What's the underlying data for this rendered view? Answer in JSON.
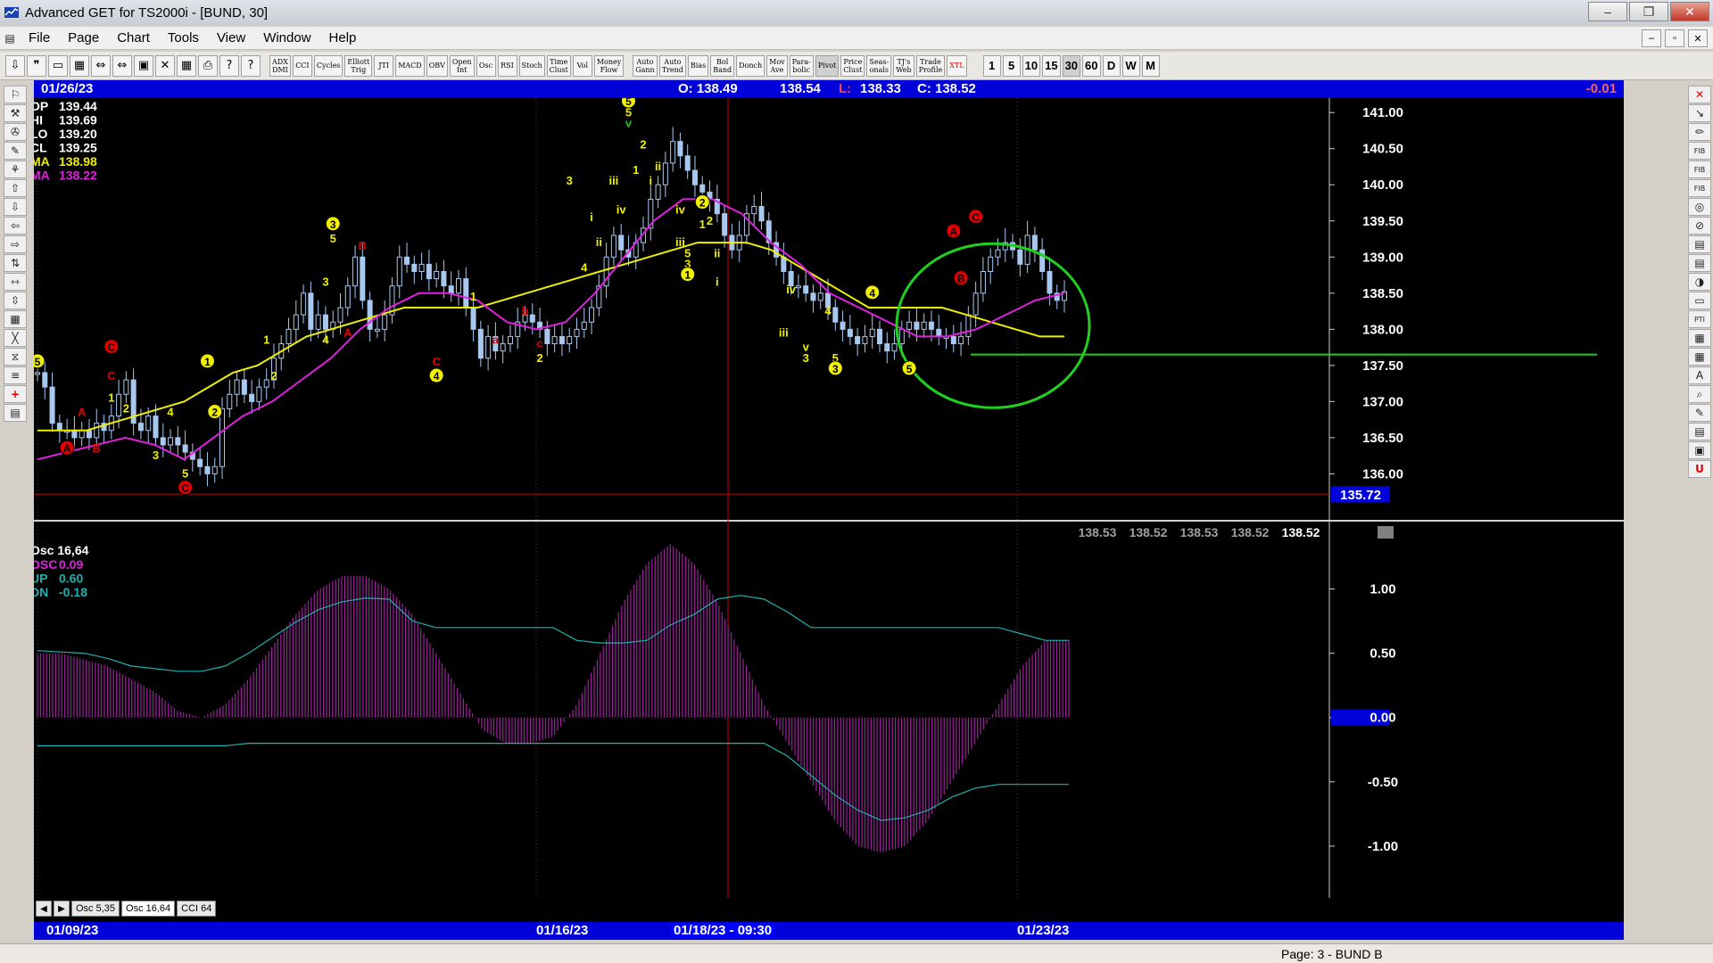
{
  "window": {
    "title": "Advanced GET for TS2000i - [BUND, 30]",
    "minimize": "‒",
    "restore": "❐",
    "close": "✕"
  },
  "menu": {
    "items": [
      "File",
      "Page",
      "Chart",
      "Tools",
      "View",
      "Window",
      "Help"
    ],
    "mdi": [
      "–",
      "▫",
      "✕"
    ]
  },
  "toolbar": {
    "icons1": [
      "⇩",
      "❞",
      "▭",
      "▦",
      "⇔",
      "⇔",
      "▣",
      "✕",
      "▦",
      "⎙",
      "?",
      "?"
    ],
    "studies": [
      {
        "label": "ADX\nDMI"
      },
      {
        "label": "CCI"
      },
      {
        "label": "Cycles"
      },
      {
        "label": "Elliott\nTrig"
      },
      {
        "label": "JTI"
      },
      {
        "label": "MACD"
      },
      {
        "label": "OBV"
      },
      {
        "label": "Open\nInt"
      },
      {
        "label": "Osc"
      },
      {
        "label": "RSI"
      },
      {
        "label": "Stoch"
      },
      {
        "label": "Time\nClust"
      },
      {
        "label": "Vol"
      },
      {
        "label": "Money\nFlow"
      }
    ],
    "studies2": [
      {
        "label": "Auto\nGann"
      },
      {
        "label": "Auto\nTrend"
      },
      {
        "label": "Bias"
      },
      {
        "label": "Bol\nBand"
      },
      {
        "label": "Donch"
      },
      {
        "label": "Mov\nAve"
      },
      {
        "label": "Para-\nbolic"
      },
      {
        "label": "Pivot"
      },
      {
        "label": "Price\nClust"
      },
      {
        "label": "Seas-\nonals"
      },
      {
        "label": "TJ's\nWeb"
      },
      {
        "label": "Trade\nProfile"
      },
      {
        "label": "XTL"
      }
    ],
    "timeframes": [
      "1",
      "5",
      "10",
      "15",
      "30",
      "60",
      "D",
      "W",
      "M"
    ],
    "active_timeframe": "30"
  },
  "left_tools": [
    "⚐",
    "⚒",
    "✇",
    "✎",
    "⚘",
    "⇧",
    "⇩",
    "⇦",
    "⇨",
    "⇅",
    "⇿",
    "⇳",
    "▦",
    "╳",
    "⧖",
    "≡",
    "+",
    "▤"
  ],
  "right_tools": [
    "✕",
    "↘",
    "✏",
    "FIB",
    "FIB",
    "FIB",
    "◎",
    "⊘",
    "▤",
    "▤",
    "◑",
    "▭",
    "PTI",
    "▦",
    "▦",
    "A",
    "⌕",
    "✎",
    "▤",
    "▣",
    "U"
  ],
  "info": {
    "date": "01/26/23",
    "open": "O: 138.49",
    "high": "138.54",
    "low_label": "L:",
    "low": "138.33",
    "close": "C: 138.52",
    "change": "-0.01"
  },
  "readout": [
    {
      "label": "OP",
      "value": "139.44",
      "color": "#ffffff"
    },
    {
      "label": "HI",
      "value": "139.69",
      "color": "#ffffff"
    },
    {
      "label": "LO",
      "value": "139.20",
      "color": "#ffffff"
    },
    {
      "label": "CL",
      "value": "139.25",
      "color": "#ffffff"
    },
    {
      "label": "MA",
      "value": "138.98",
      "color": "#f0f000"
    },
    {
      "label": "MA",
      "value": "138.22",
      "color": "#e020e0"
    }
  ],
  "price_axis": {
    "labels": [
      "141.00",
      "140.50",
      "140.00",
      "139.50",
      "139.00",
      "138.50",
      "138.00",
      "137.50",
      "137.00",
      "136.50",
      "136.00"
    ],
    "values": [
      141,
      140.5,
      140,
      139.5,
      139,
      138.5,
      138,
      137.5,
      137,
      136.5,
      136
    ],
    "highlight_label": "135.72",
    "highlight_value": 135.72,
    "min": 135.4,
    "max": 141.2
  },
  "price_history_row": [
    "138.53",
    "138.52",
    "138.53",
    "138.52",
    "138.52"
  ],
  "osc": {
    "title": "Osc 16,64",
    "legend": [
      {
        "label": "OSC",
        "value": "0.09",
        "color": "#e020e0"
      },
      {
        "label": "UP",
        "value": "0.60",
        "color": "#20b0b0"
      },
      {
        "label": "DN",
        "value": "-0.18",
        "color": "#20b0b0"
      }
    ],
    "axis_labels": [
      "1.00",
      "0.50",
      "0.00",
      "-0.50",
      "-1.00"
    ],
    "axis_values": [
      1,
      0.5,
      0,
      -0.5,
      -1
    ],
    "highlight_label": "0.00",
    "min": -1.25,
    "max": 1.35
  },
  "tabs": [
    "Osc 5,35",
    "Osc 16,64",
    "CCI 64"
  ],
  "active_tab": "Osc 16,64",
  "dates": [
    "01/09/23",
    "01/16/23",
    "01/18/23 - 09:30",
    "01/23/23"
  ],
  "status": "Page: 3 - BUND B",
  "colors": {
    "background": "#000000",
    "candle": "#a8c8f0",
    "ma_fast": "#f0f000",
    "ma_slow": "#e020e0",
    "circle": "#20d020",
    "support_line": "#20d020",
    "osc_bars": "#a020a0",
    "bands": "#20b0b0",
    "cursor_line": "#d00000",
    "info_bar": "#0000d8"
  },
  "chart_data": {
    "type": "candlestick",
    "closes": [
      137.4,
      137.2,
      136.7,
      136.6,
      136.6,
      136.5,
      136.6,
      136.5,
      136.7,
      136.6,
      136.8,
      137.1,
      137.3,
      136.7,
      136.6,
      136.8,
      136.5,
      136.4,
      136.5,
      136.4,
      136.3,
      136.2,
      136.1,
      136.0,
      136.1,
      136.9,
      137.1,
      137.3,
      137.1,
      137.0,
      137.2,
      137.3,
      137.6,
      137.8,
      138.0,
      138.2,
      138.5,
      138.0,
      138.2,
      138.0,
      138.1,
      138.3,
      138.6,
      139.0,
      138.4,
      138.0,
      138.0,
      138.2,
      138.6,
      139.0,
      138.9,
      138.8,
      138.9,
      138.7,
      138.8,
      138.6,
      138.5,
      138.7,
      138.3,
      138.0,
      137.6,
      137.9,
      137.7,
      137.8,
      137.9,
      138.1,
      138.2,
      138.1,
      138.0,
      137.8,
      137.9,
      137.8,
      137.9,
      138.0,
      138.1,
      138.3,
      138.6,
      139.0,
      139.3,
      139.1,
      139.0,
      139.2,
      139.4,
      139.8,
      140.0,
      140.3,
      140.6,
      140.4,
      140.2,
      140.0,
      139.9,
      139.8,
      139.6,
      139.3,
      139.1,
      139.3,
      139.6,
      139.7,
      139.5,
      139.2,
      139.0,
      138.8,
      138.6,
      138.6,
      138.5,
      138.4,
      138.5,
      138.3,
      138.1,
      138.0,
      137.9,
      137.8,
      137.9,
      138.0,
      137.8,
      137.7,
      137.8,
      138.0,
      138.1,
      138.0,
      138.1,
      138.0,
      137.9,
      137.9,
      137.8,
      137.9,
      138.2,
      138.5,
      138.8,
      139.0,
      139.1,
      139.2,
      139.1,
      138.9,
      139.3,
      139.1,
      138.8,
      138.5,
      138.4,
      138.52
    ],
    "ma_fast": [
      136.6,
      136.6,
      136.6,
      136.7,
      136.8,
      136.9,
      137.0,
      137.2,
      137.4,
      137.5,
      137.7,
      137.9,
      138.0,
      138.1,
      138.2,
      138.3,
      138.3,
      138.3,
      138.3,
      138.4,
      138.5,
      138.6,
      138.7,
      138.8,
      138.9,
      139.0,
      139.1,
      139.2,
      139.2,
      139.2,
      139.1,
      138.9,
      138.7,
      138.5,
      138.3,
      138.3,
      138.3,
      138.3,
      138.2,
      138.1,
      138.0,
      137.9,
      137.9
    ],
    "ma_slow": [
      136.2,
      136.3,
      136.4,
      136.5,
      136.4,
      136.2,
      136.5,
      136.8,
      137.0,
      137.3,
      137.6,
      138.0,
      138.3,
      138.5,
      138.5,
      138.4,
      138.1,
      138.0,
      138.1,
      138.5,
      139.0,
      139.5,
      139.8,
      139.8,
      139.6,
      139.2,
      138.9,
      138.5,
      138.3,
      138.1,
      137.9,
      137.9,
      138.0,
      138.2,
      138.4,
      138.5
    ],
    "osc": [
      0.5,
      0.5,
      0.45,
      0.4,
      0.3,
      0.2,
      0.05,
      0.0,
      0.1,
      0.3,
      0.55,
      0.8,
      1.0,
      1.1,
      1.1,
      1.0,
      0.8,
      0.5,
      0.2,
      -0.1,
      -0.2,
      -0.2,
      -0.15,
      0.1,
      0.5,
      0.9,
      1.2,
      1.35,
      1.2,
      0.9,
      0.5,
      0.1,
      -0.2,
      -0.5,
      -0.8,
      -1.0,
      -1.05,
      -1.0,
      -0.8,
      -0.5,
      -0.2,
      0.1,
      0.4,
      0.6,
      0.6
    ],
    "upper_band": [
      0.52,
      0.51,
      0.5,
      0.46,
      0.4,
      0.38,
      0.36,
      0.36,
      0.4,
      0.5,
      0.62,
      0.74,
      0.84,
      0.9,
      0.93,
      0.92,
      0.75,
      0.7,
      0.7,
      0.7,
      0.7,
      0.7,
      0.7,
      0.6,
      0.58,
      0.58,
      0.6,
      0.72,
      0.8,
      0.92,
      0.95,
      0.92,
      0.82,
      0.7,
      0.7,
      0.7,
      0.7,
      0.7,
      0.7,
      0.7,
      0.7,
      0.7,
      0.65,
      0.6,
      0.6
    ],
    "lower_band": [
      -0.22,
      -0.22,
      -0.22,
      -0.22,
      -0.22,
      -0.22,
      -0.22,
      -0.22,
      -0.22,
      -0.2,
      -0.2,
      -0.2,
      -0.2,
      -0.2,
      -0.2,
      -0.2,
      -0.2,
      -0.2,
      -0.2,
      -0.2,
      -0.2,
      -0.2,
      -0.2,
      -0.2,
      -0.2,
      -0.2,
      -0.2,
      -0.2,
      -0.2,
      -0.2,
      -0.2,
      -0.2,
      -0.3,
      -0.45,
      -0.6,
      -0.72,
      -0.8,
      -0.78,
      -0.72,
      -0.62,
      -0.55,
      -0.52,
      -0.52,
      -0.52,
      -0.52
    ],
    "support_level": 137.65,
    "low_line_level": 135.72
  },
  "wave_labels": [
    {
      "t": "5",
      "c": "#f0f000",
      "idx": 0,
      "p": 137.5,
      "circle": true,
      "circleColor": "#e00000",
      "ring": "C"
    },
    {
      "t": "A",
      "c": "#e00000",
      "idx": 6,
      "p": 136.8
    },
    {
      "t": "A",
      "c": "#e00000",
      "idx": 4,
      "p": 136.3,
      "circle": true
    },
    {
      "t": "B",
      "c": "#e00000",
      "idx": 8,
      "p": 136.3
    },
    {
      "t": "C",
      "c": "#e00000",
      "idx": 10,
      "p": 137.7,
      "circle": true
    },
    {
      "t": "C",
      "c": "#e00000",
      "idx": 10,
      "p": 137.3
    },
    {
      "t": "1",
      "c": "#f0f000",
      "idx": 10,
      "p": 137.0
    },
    {
      "t": "2",
      "c": "#f0f000",
      "idx": 12,
      "p": 136.85
    },
    {
      "t": "3",
      "c": "#f0f000",
      "idx": 16,
      "p": 136.2
    },
    {
      "t": "4",
      "c": "#f0f000",
      "idx": 18,
      "p": 136.8
    },
    {
      "t": "5",
      "c": "#f0f000",
      "idx": 20,
      "p": 135.95
    },
    {
      "t": "C",
      "c": "#e00000",
      "idx": 20,
      "p": 135.75,
      "circle": true
    },
    {
      "t": "1",
      "c": "#f0f000",
      "idx": 23,
      "p": 137.5,
      "circle": true
    },
    {
      "t": "2",
      "c": "#f0f000",
      "idx": 24,
      "p": 136.8,
      "circle": true
    },
    {
      "t": "1",
      "c": "#f0f000",
      "idx": 31,
      "p": 137.8
    },
    {
      "t": "2",
      "c": "#f0f000",
      "idx": 32,
      "p": 137.3
    },
    {
      "t": "3",
      "c": "#f0f000",
      "idx": 40,
      "p": 139.4,
      "circle": true
    },
    {
      "t": "5",
      "c": "#f0f000",
      "idx": 40,
      "p": 139.2
    },
    {
      "t": "3",
      "c": "#f0f000",
      "idx": 39,
      "p": 138.6
    },
    {
      "t": "4",
      "c": "#f0f000",
      "idx": 39,
      "p": 137.8
    },
    {
      "t": "A",
      "c": "#e00000",
      "idx": 42,
      "p": 137.9
    },
    {
      "t": "B",
      "c": "#e00000",
      "idx": 44,
      "p": 139.1
    },
    {
      "t": "C",
      "c": "#e00000",
      "idx": 54,
      "p": 137.5
    },
    {
      "t": "4",
      "c": "#f0f000",
      "idx": 54,
      "p": 137.3,
      "circle": true
    },
    {
      "t": "1",
      "c": "#f0f000",
      "idx": 59,
      "p": 138.4
    },
    {
      "t": "b",
      "c": "#e00000",
      "idx": 66,
      "p": 138.2
    },
    {
      "t": "a",
      "c": "#e00000",
      "idx": 62,
      "p": 137.8
    },
    {
      "t": "c",
      "c": "#e00000",
      "idx": 68,
      "p": 137.75
    },
    {
      "t": "2",
      "c": "#f0f000",
      "idx": 68,
      "p": 137.55
    },
    {
      "t": "3",
      "c": "#f0f000",
      "idx": 72,
      "p": 140.0
    },
    {
      "t": "4",
      "c": "#f0f000",
      "idx": 74,
      "p": 138.8
    },
    {
      "t": "i",
      "c": "#f0f000",
      "idx": 75,
      "p": 139.5
    },
    {
      "t": "ii",
      "c": "#f0f000",
      "idx": 76,
      "p": 139.15
    },
    {
      "t": "iii",
      "c": "#f0f000",
      "idx": 78,
      "p": 140.0
    },
    {
      "t": "iv",
      "c": "#f0f000",
      "idx": 79,
      "p": 139.6
    },
    {
      "t": "5",
      "c": "#f0f000",
      "idx": 80,
      "p": 141.1,
      "circle": true
    },
    {
      "t": "5",
      "c": "#f0f000",
      "idx": 80,
      "p": 140.95
    },
    {
      "t": "v",
      "c": "#20c020",
      "idx": 80,
      "p": 140.8
    },
    {
      "t": "2",
      "c": "#f0f000",
      "idx": 82,
      "p": 140.5
    },
    {
      "t": "1",
      "c": "#f0f000",
      "idx": 81,
      "p": 140.15
    },
    {
      "t": "i",
      "c": "#f0f000",
      "idx": 83,
      "p": 140.0
    },
    {
      "t": "ii",
      "c": "#f0f000",
      "idx": 84,
      "p": 140.2
    },
    {
      "t": "iv",
      "c": "#f0f000",
      "idx": 87,
      "p": 139.6
    },
    {
      "t": "2",
      "c": "#f0f000",
      "idx": 90,
      "p": 139.7,
      "circle": true
    },
    {
      "t": "1",
      "c": "#f0f000",
      "idx": 90,
      "p": 139.4
    },
    {
      "t": "2",
      "c": "#f0f000",
      "idx": 91,
      "p": 139.45
    },
    {
      "t": "iii",
      "c": "#f0f000",
      "idx": 87,
      "p": 139.15
    },
    {
      "t": "5",
      "c": "#f0f000",
      "idx": 88,
      "p": 139.0
    },
    {
      "t": "3",
      "c": "#f0f000",
      "idx": 88,
      "p": 138.85
    },
    {
      "t": "1",
      "c": "#f0f000",
      "idx": 88,
      "p": 138.7,
      "circle": true
    },
    {
      "t": "ii",
      "c": "#f0f000",
      "idx": 92,
      "p": 139.0
    },
    {
      "t": "i",
      "c": "#f0f000",
      "idx": 92,
      "p": 138.6
    },
    {
      "t": "iv",
      "c": "#f0f000",
      "idx": 102,
      "p": 138.5
    },
    {
      "t": "iii",
      "c": "#f0f000",
      "idx": 101,
      "p": 137.9
    },
    {
      "t": "4",
      "c": "#f0f000",
      "idx": 107,
      "p": 138.2
    },
    {
      "t": "v",
      "c": "#f0f000",
      "idx": 104,
      "p": 137.7
    },
    {
      "t": "3",
      "c": "#f0f000",
      "idx": 104,
      "p": 137.55
    },
    {
      "t": "5",
      "c": "#f0f000",
      "idx": 108,
      "p": 137.55
    },
    {
      "t": "3",
      "c": "#f0f000",
      "idx": 108,
      "p": 137.4,
      "circle": true
    },
    {
      "t": "4",
      "c": "#f0f000",
      "idx": 113,
      "p": 138.45,
      "circle": true
    },
    {
      "t": "5",
      "c": "#f0f000",
      "idx": 118,
      "p": 137.4,
      "circle": true
    },
    {
      "t": "A",
      "c": "#e00000",
      "idx": 124,
      "p": 139.3,
      "circle": true
    },
    {
      "t": "C",
      "c": "#e00000",
      "idx": 127,
      "p": 139.5,
      "circle": true
    },
    {
      "t": "B",
      "c": "#e00000",
      "idx": 125,
      "p": 138.65,
      "circle": true
    }
  ]
}
